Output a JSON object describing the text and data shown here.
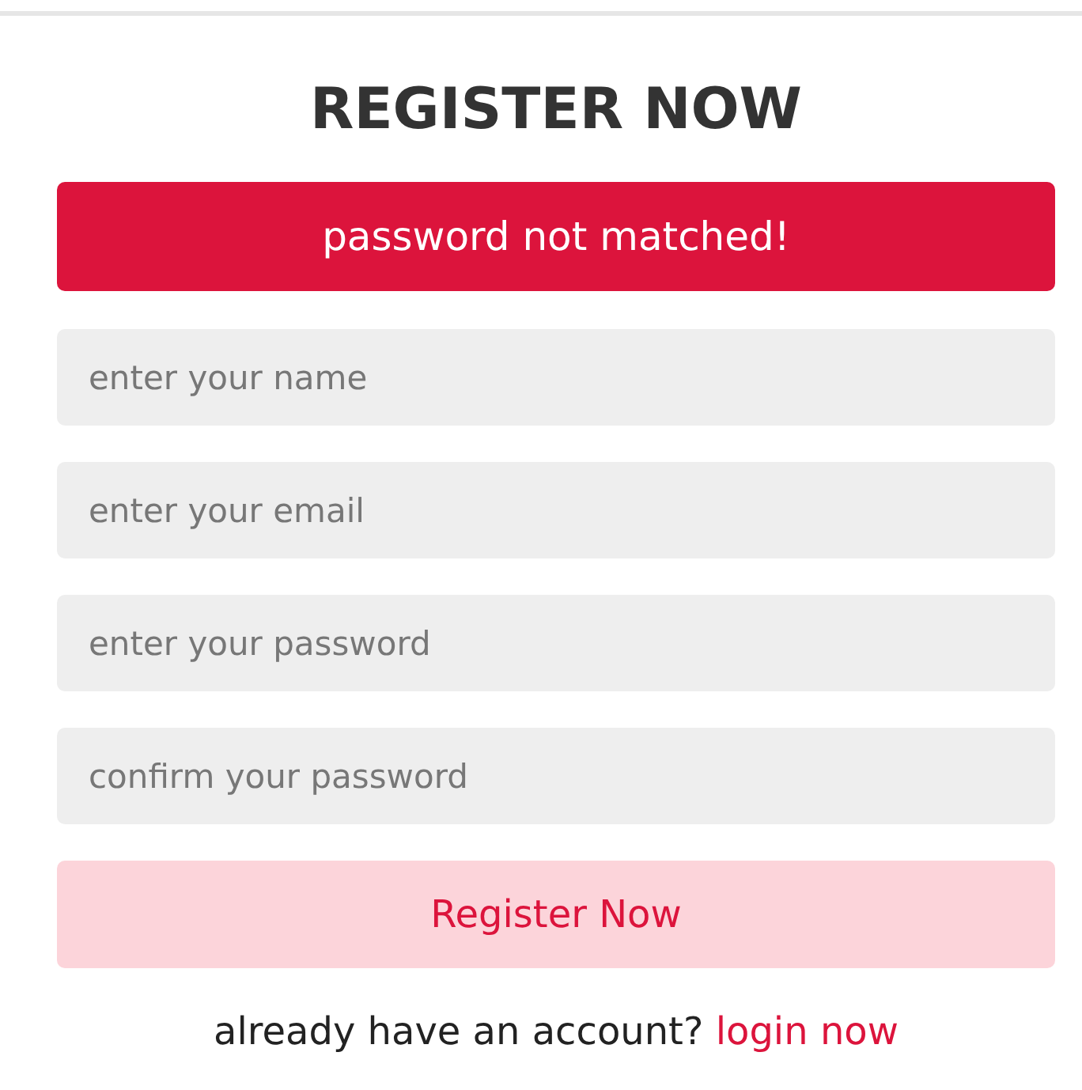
{
  "title": "REGISTER NOW",
  "message": "password not matched!",
  "fields": [
    {
      "placeholder": "enter your name"
    },
    {
      "placeholder": "enter your email"
    },
    {
      "placeholder": "enter your password"
    },
    {
      "placeholder": "confirm your password"
    }
  ],
  "submit": "Register Now",
  "footer": {
    "text": "already have an account?",
    "link": "login now"
  }
}
